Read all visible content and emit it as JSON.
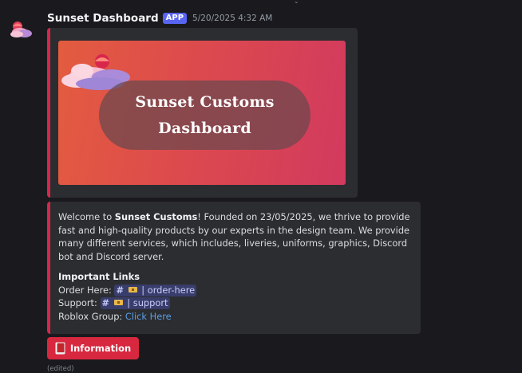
{
  "message": {
    "username": "Sunset Dashboard",
    "app_badge": "APP",
    "timestamp": "5/20/2025 4:32 AM",
    "edited_label": "(edited)"
  },
  "banner": {
    "line1": "Sunset Customs",
    "line2": "Dashboard"
  },
  "description": {
    "welcome_prefix": "Welcome to ",
    "brand": "Sunset Customs",
    "body": "! Founded on 23/05/2025, we thrive to provide fast and high-quality products by our experts in the design team. We provide many different services, which includes, liveries, uniforms, graphics, Discord bot and Discord server."
  },
  "links": {
    "title": "Important Links",
    "order_label": "Order Here: ",
    "order_channel": "| order-here",
    "support_label": "Support: ",
    "support_channel": "| support",
    "roblox_label": "Roblox Group: ",
    "roblox_link": "Click Here"
  },
  "button": {
    "label": "Information",
    "icon": "book-icon"
  },
  "colors": {
    "accent": "#d8264d",
    "app_badge": "#5865f2",
    "button": "#d8283f",
    "link": "#5c9ee6"
  }
}
